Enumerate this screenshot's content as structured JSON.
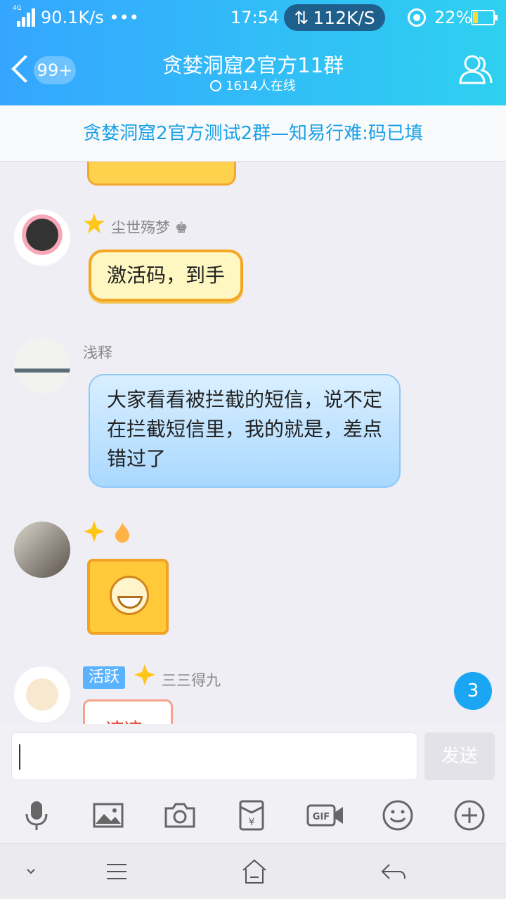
{
  "status": {
    "net_label": "4G",
    "speed": "90.1K/s",
    "dots": "•••",
    "time": "17:54",
    "transfer": "112K/S",
    "battery_pct": "22%",
    "battery_level": 0.22
  },
  "header": {
    "back_badge": "99+",
    "title": "贪婪洞窟2官方11群",
    "online": "1614人在线"
  },
  "notice": "贪婪洞窟2官方测试2群—知易行难:码已填",
  "messages": [
    {
      "name": "尘世殇梦",
      "name_suffix": "♚",
      "text": "激活码，到手"
    },
    {
      "name": "浅释",
      "text": "大家看看被拦截的短信，说不定在拦截短信里，我的就是，差点错过了"
    },
    {
      "name": "",
      "type": "sticker"
    },
    {
      "tag": "活跃",
      "name": "三三得九",
      "sticker_text": "凉凉"
    }
  ],
  "unread_count": "3",
  "input": {
    "value": "",
    "send_label": "发送"
  },
  "tools": [
    "mic-icon",
    "image-icon",
    "camera-icon",
    "red-packet-icon",
    "gif-icon",
    "emoji-icon",
    "plus-icon"
  ],
  "colors": {
    "accent": "#35a6ff",
    "notice": "#1aa0e6",
    "bubble_blue": "#a9d8ff",
    "bubble_yellow": "#fff7c2"
  }
}
